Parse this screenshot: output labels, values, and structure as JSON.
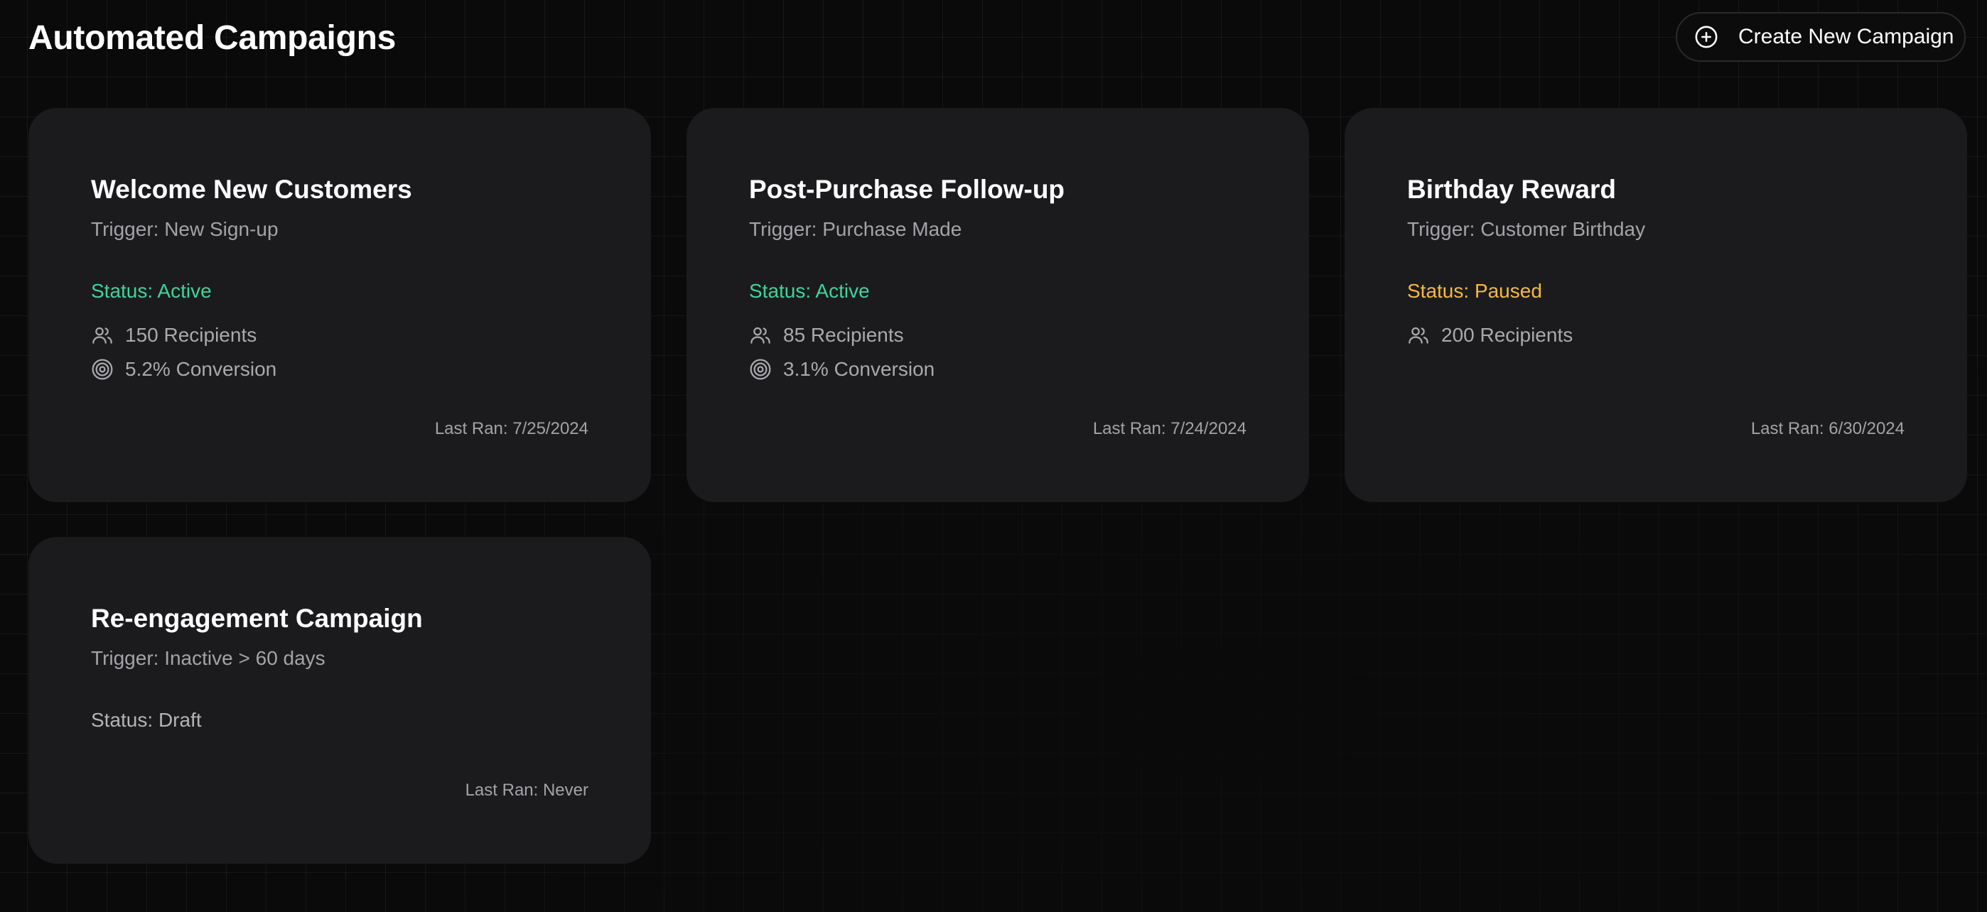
{
  "header": {
    "title": "Automated Campaigns",
    "create_button_label": "Create New Campaign"
  },
  "colors": {
    "active": "#3fd49a",
    "paused": "#f5b942",
    "draft": "#b4b4b8",
    "card_bg": "#1b1b1d",
    "page_bg": "#0a0a0a"
  },
  "icons": {
    "create": "plus-circle-icon",
    "recipients": "users-icon",
    "conversion": "target-icon"
  },
  "campaigns": [
    {
      "title": "Welcome New Customers",
      "trigger": "Trigger: New Sign-up",
      "status": "Status: Active",
      "recipients": "150 Recipients",
      "conversion": "5.2% Conversion",
      "last_ran": "Last Ran: 7/25/2024"
    },
    {
      "title": "Post-Purchase Follow-up",
      "trigger": "Trigger: Purchase Made",
      "status": "Status: Active",
      "recipients": "85 Recipients",
      "conversion": "3.1% Conversion",
      "last_ran": "Last Ran: 7/24/2024"
    },
    {
      "title": "Birthday Reward",
      "trigger": "Trigger: Customer Birthday",
      "status": "Status: Paused",
      "recipients": "200 Recipients",
      "last_ran": "Last Ran: 6/30/2024"
    },
    {
      "title": "Re-engagement Campaign",
      "trigger": "Trigger: Inactive > 60 days",
      "status": "Status: Draft",
      "last_ran": "Last Ran: Never"
    }
  ]
}
